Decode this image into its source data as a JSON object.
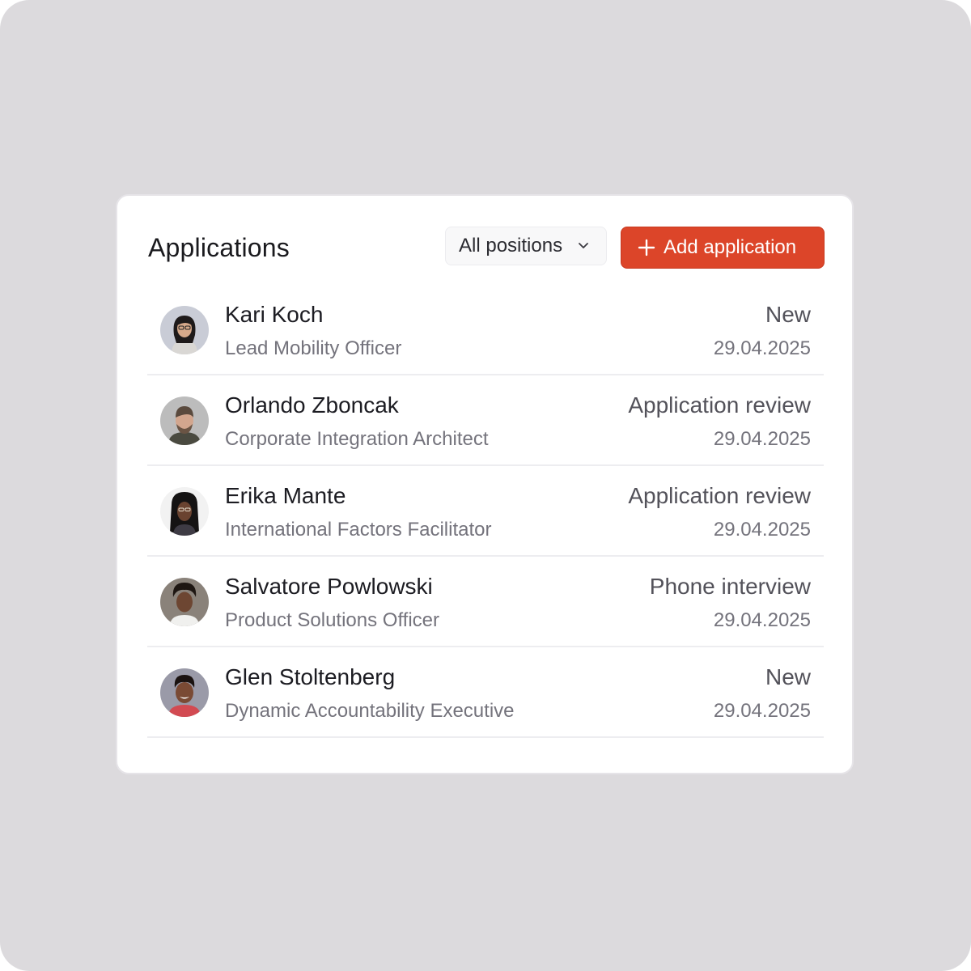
{
  "header": {
    "title": "Applications",
    "filter_value": "All positions",
    "add_label": "Add application"
  },
  "colors": {
    "accent": "#dc4529",
    "backdrop": "#dcdadd",
    "card": "#ffffff"
  },
  "applications": [
    {
      "name": "Kari Koch",
      "role": "Lead Mobility Officer",
      "status": "New",
      "date": "29.04.2025",
      "avatar": "avatar-photo"
    },
    {
      "name": "Orlando Zboncak",
      "role": "Corporate Integration Architect",
      "status": "Application review",
      "date": "29.04.2025",
      "avatar": "avatar-photo"
    },
    {
      "name": "Erika Mante",
      "role": "International Factors Facilitator",
      "status": "Application review",
      "date": "29.04.2025",
      "avatar": "avatar-photo"
    },
    {
      "name": "Salvatore Powlowski",
      "role": "Product Solutions Officer",
      "status": "Phone interview",
      "date": "29.04.2025",
      "avatar": "avatar-photo"
    },
    {
      "name": "Glen Stoltenberg",
      "role": "Dynamic Accountability Executive",
      "status": "New",
      "date": "29.04.2025",
      "avatar": "avatar-photo"
    }
  ]
}
